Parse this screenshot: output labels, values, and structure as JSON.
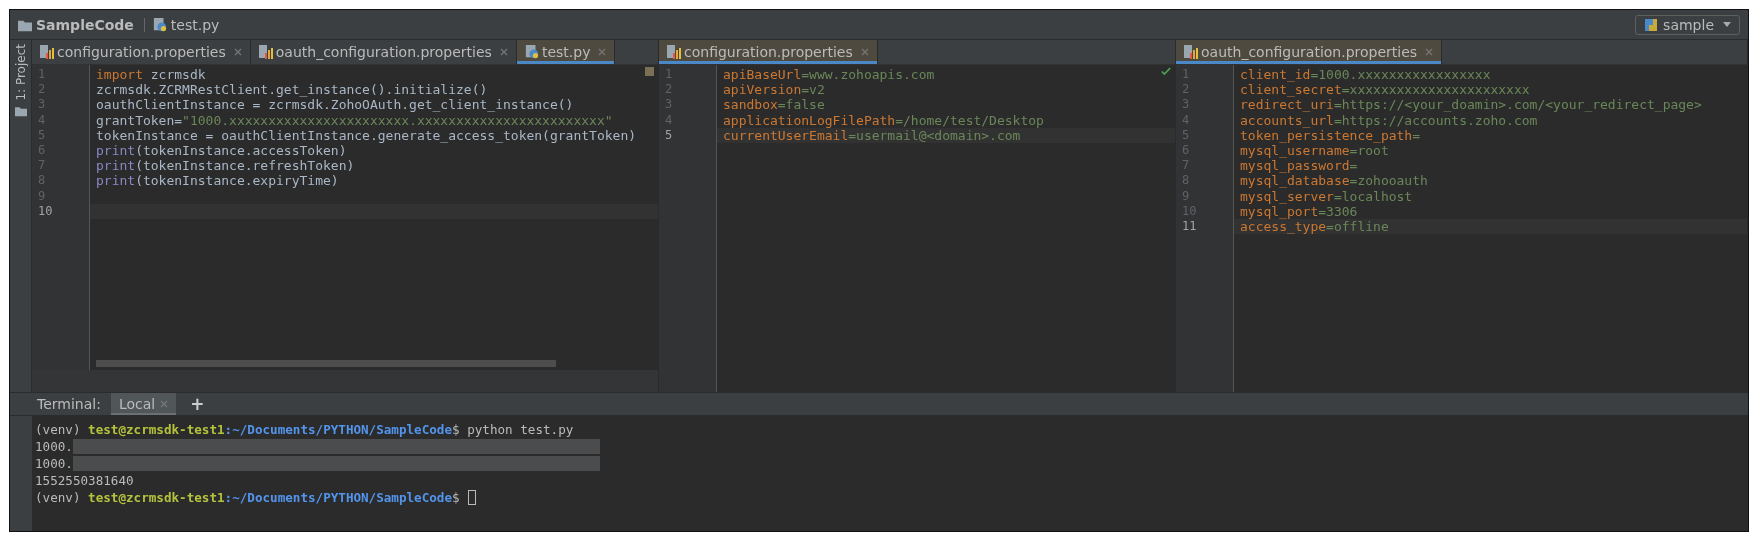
{
  "breadcrumb": [
    {
      "label": "SampleCode",
      "kind": "folder"
    },
    {
      "label": "test.py",
      "kind": "python"
    }
  ],
  "run_config": {
    "label": "sample"
  },
  "side_tool": {
    "label": "1: Project"
  },
  "editors": [
    {
      "warnings": true,
      "tabs": [
        {
          "label": "configuration.properties",
          "kind": "properties",
          "selected": false
        },
        {
          "label": "oauth_configuration.properties",
          "kind": "properties",
          "selected": false
        },
        {
          "label": "test.py",
          "kind": "python",
          "selected": true
        }
      ],
      "lines": [
        {
          "number": "1",
          "current": false,
          "tokens": [
            {
              "text": "import",
              "kind": "keyword"
            },
            {
              "text": " zcrmsdk",
              "kind": "plain"
            }
          ]
        },
        {
          "number": "2",
          "current": false,
          "tokens": [
            {
              "text": "zcrmsdk.ZCRMRestClient.get_instance().initialize()",
              "kind": "plain"
            }
          ]
        },
        {
          "number": "3",
          "current": false,
          "tokens": [
            {
              "text": "oauthClientInstance = zcrmsdk.ZohoOAuth.get_client_instance()",
              "kind": "plain"
            }
          ]
        },
        {
          "number": "4",
          "current": false,
          "tokens": [
            {
              "text": "grantToken=",
              "kind": "plain"
            },
            {
              "text": "\"1000.xxxxxxxxxxxxxxxxxxxxxxx.xxxxxxxxxxxxxxxxxxxxxxxx\"",
              "kind": "string"
            }
          ]
        },
        {
          "number": "5",
          "current": false,
          "tokens": [
            {
              "text": "tokenInstance = oauthClientInstance.generate_access_token(grantToken)",
              "kind": "plain"
            }
          ]
        },
        {
          "number": "6",
          "current": false,
          "tokens": [
            {
              "text": "print",
              "kind": "builtin"
            },
            {
              "text": "(tokenInstance.accessToken)",
              "kind": "plain"
            }
          ]
        },
        {
          "number": "7",
          "current": false,
          "tokens": [
            {
              "text": "print",
              "kind": "builtin"
            },
            {
              "text": "(tokenInstance.refreshToken)",
              "kind": "plain"
            }
          ]
        },
        {
          "number": "8",
          "current": false,
          "tokens": [
            {
              "text": "print",
              "kind": "builtin"
            },
            {
              "text": "(tokenInstance.expiryTime)",
              "kind": "plain"
            }
          ]
        },
        {
          "number": "9",
          "current": false
        },
        {
          "number": "10",
          "current": true
        }
      ]
    },
    {
      "warnings": false,
      "tabs": [
        {
          "label": "configuration.properties",
          "kind": "properties",
          "selected": true
        }
      ],
      "lines": [
        {
          "number": "1",
          "current": false,
          "tokens": [
            {
              "text": "apiBaseUrl",
              "kind": "key"
            },
            {
              "text": "=www.zohoapis.com",
              "kind": "value"
            }
          ]
        },
        {
          "number": "2",
          "current": false,
          "tokens": [
            {
              "text": "apiVersion",
              "kind": "key"
            },
            {
              "text": "=v2",
              "kind": "value"
            }
          ]
        },
        {
          "number": "3",
          "current": false,
          "tokens": [
            {
              "text": "sandbox",
              "kind": "key"
            },
            {
              "text": "=false",
              "kind": "value"
            }
          ]
        },
        {
          "number": "4",
          "current": false,
          "tokens": [
            {
              "text": "applicationLogFilePath",
              "kind": "key"
            },
            {
              "text": "=/home/test/Desktop",
              "kind": "value"
            }
          ]
        },
        {
          "number": "5",
          "current": true,
          "tokens": [
            {
              "text": "currentUserEmail",
              "kind": "key"
            },
            {
              "text": "=usermail@<domain>.com",
              "kind": "value"
            }
          ]
        }
      ]
    },
    {
      "tabs": [
        {
          "label": "oauth_configuration.properties",
          "kind": "properties",
          "selected": true
        }
      ],
      "lines": [
        {
          "number": "1",
          "current": false,
          "tokens": [
            {
              "text": "client_id",
              "kind": "key"
            },
            {
              "text": "=1000.xxxxxxxxxxxxxxxxx",
              "kind": "value"
            }
          ]
        },
        {
          "number": "2",
          "current": false,
          "tokens": [
            {
              "text": "client_secret",
              "kind": "key"
            },
            {
              "text": "=xxxxxxxxxxxxxxxxxxxxxxx",
              "kind": "value"
            }
          ]
        },
        {
          "number": "3",
          "current": false,
          "tokens": [
            {
              "text": "redirect_uri",
              "kind": "key"
            },
            {
              "text": "=https://<your_doamin>.com/<your_redirect_page>",
              "kind": "value"
            }
          ]
        },
        {
          "number": "4",
          "current": false,
          "tokens": [
            {
              "text": "accounts_url",
              "kind": "key"
            },
            {
              "text": "=https://accounts.zoho.com",
              "kind": "value"
            }
          ]
        },
        {
          "number": "5",
          "current": false,
          "tokens": [
            {
              "text": "token_persistence_path",
              "kind": "key"
            },
            {
              "text": "=",
              "kind": "value"
            }
          ]
        },
        {
          "number": "6",
          "current": false,
          "tokens": [
            {
              "text": "mysql_username",
              "kind": "key"
            },
            {
              "text": "=root",
              "kind": "value"
            }
          ]
        },
        {
          "number": "7",
          "current": false,
          "tokens": [
            {
              "text": "mysql_password",
              "kind": "key"
            },
            {
              "text": "=",
              "kind": "value"
            }
          ]
        },
        {
          "number": "8",
          "current": false,
          "tokens": [
            {
              "text": "mysql_database",
              "kind": "key"
            },
            {
              "text": "=zohooauth",
              "kind": "value"
            }
          ]
        },
        {
          "number": "9",
          "current": false,
          "tokens": [
            {
              "text": "mysql_server",
              "kind": "key"
            },
            {
              "text": "=localhost",
              "kind": "value"
            }
          ]
        },
        {
          "number": "10",
          "current": false,
          "tokens": [
            {
              "text": "mysql_port",
              "kind": "key"
            },
            {
              "text": "=3306",
              "kind": "value"
            }
          ]
        },
        {
          "number": "11",
          "current": true,
          "tokens": [
            {
              "text": "access_type",
              "kind": "key"
            },
            {
              "text": "=offline",
              "kind": "value"
            }
          ]
        }
      ]
    }
  ],
  "terminal": {
    "title": "Terminal:",
    "tabs": [
      {
        "label": "Local",
        "selected": true
      }
    ],
    "add_label": "+",
    "lines": [
      {
        "kind": "prompt",
        "cursor": false,
        "venv": "(venv)",
        "user": "test@zcrmsdk-test1",
        "path": ":~/Documents/PYTHON/SampleCode",
        "command": "$ python test.py"
      },
      {
        "kind": "output",
        "redacted": true,
        "text": "1000."
      },
      {
        "kind": "output",
        "redacted": true,
        "text": "1000."
      },
      {
        "kind": "output",
        "redacted": false,
        "text": "1552550381640"
      },
      {
        "kind": "prompt",
        "cursor": true,
        "venv": "(venv)",
        "user": "test@zcrmsdk-test1",
        "path": ":~/Documents/PYTHON/SampleCode",
        "command": "$"
      }
    ]
  }
}
